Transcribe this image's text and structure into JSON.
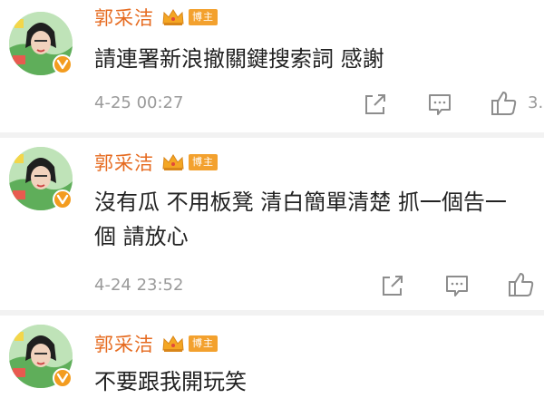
{
  "posts": [
    {
      "user": {
        "name": "郭采洁",
        "badge": "博主"
      },
      "text_lines": [
        "請連署新浪撤關鍵搜索詞 感謝"
      ],
      "time": "4-25 00:27",
      "like_count": "3."
    },
    {
      "user": {
        "name": "郭采洁",
        "badge": "博主"
      },
      "text_lines": [
        "沒有瓜 不用板凳 清白簡單清楚 抓一個告一",
        "個 請放心"
      ],
      "time": "4-24 23:52",
      "like_count": ""
    },
    {
      "user": {
        "name": "郭采洁",
        "badge": "博主"
      },
      "text_lines": [
        "不要跟我開玩笑"
      ],
      "time": "",
      "like_count": ""
    }
  ],
  "icons": {
    "share": "share-icon",
    "comment": "comment-icon",
    "like": "like-icon",
    "crown": "crown-icon",
    "verified": "verified-v-icon"
  },
  "colors": {
    "username": "#e66b20",
    "badge": "#f3a12e",
    "crown": "#f4a623",
    "verified": "#f39c1f",
    "text": "#222222",
    "meta": "#9a9a9a"
  }
}
